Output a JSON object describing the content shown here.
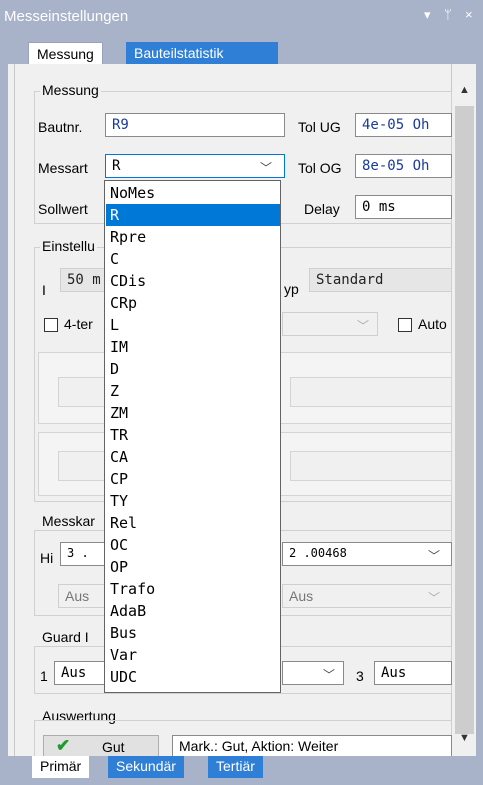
{
  "window": {
    "title": "Messeinstellungen",
    "controls": [
      "▾",
      "ᛘ",
      "×"
    ]
  },
  "tabs": [
    {
      "label": "Messung",
      "active": true
    },
    {
      "label": "Bauteilstatistik",
      "active": false
    }
  ],
  "messung": {
    "group_title": "Messung",
    "bautnr_label": "Bautnr.",
    "bautnr_value": "R9",
    "messart_label": "Messart",
    "messart_value": "R",
    "sollwert_label": "Sollwert",
    "tol_ug_label": "Tol UG",
    "tol_ug_value": "4e-05 Oh",
    "tol_og_label": "Tol OG",
    "tol_og_value": "8e-05 Oh",
    "delay_label": "Delay",
    "delay_value": "0 ms"
  },
  "einstellung": {
    "group_title": "Einstellu",
    "i_label": "I",
    "i_value": "50 m",
    "typ_label": "yp",
    "typ_value": "Standard",
    "four_term_label": "4-ter",
    "auto_label": "Auto"
  },
  "messkanal": {
    "group_title": "Messkar",
    "hi_label": "Hi",
    "hi_value": "3  .",
    "lo_value": "2  .00468",
    "aus_left": "Aus",
    "aus_right": "Aus"
  },
  "guard": {
    "group_title": "Guard I",
    "one_label": "1",
    "one_value": "Aus",
    "three_label": "3",
    "three_value": "Aus"
  },
  "auswertung": {
    "group_title": "Auswertung",
    "gut_label": "Gut",
    "mark_text": "Mark.: Gut, Aktion: Weiter"
  },
  "dropdown": {
    "selected": "R",
    "options": [
      "NoMes",
      "R",
      "Rpre",
      "C",
      "CDis",
      "CRp",
      "L",
      "IM",
      "D",
      "Z",
      "ZM",
      "TR",
      "CA",
      "CP",
      "TY",
      "Rel",
      "OC",
      "OP",
      "Trafo",
      "AdaB",
      "Bus",
      "Var",
      "UDC"
    ]
  },
  "bottom_tabs": [
    {
      "label": "Primär",
      "active": true
    },
    {
      "label": "Sekundär",
      "active": false
    },
    {
      "label": "Tertiär",
      "active": false
    }
  ],
  "colors": {
    "accent": "#0078d7",
    "tab_blue": "#2f7fd6",
    "frame": "#a8b2c8",
    "value_blue": "#1a3a9c",
    "check_green": "#1e9a2e"
  }
}
